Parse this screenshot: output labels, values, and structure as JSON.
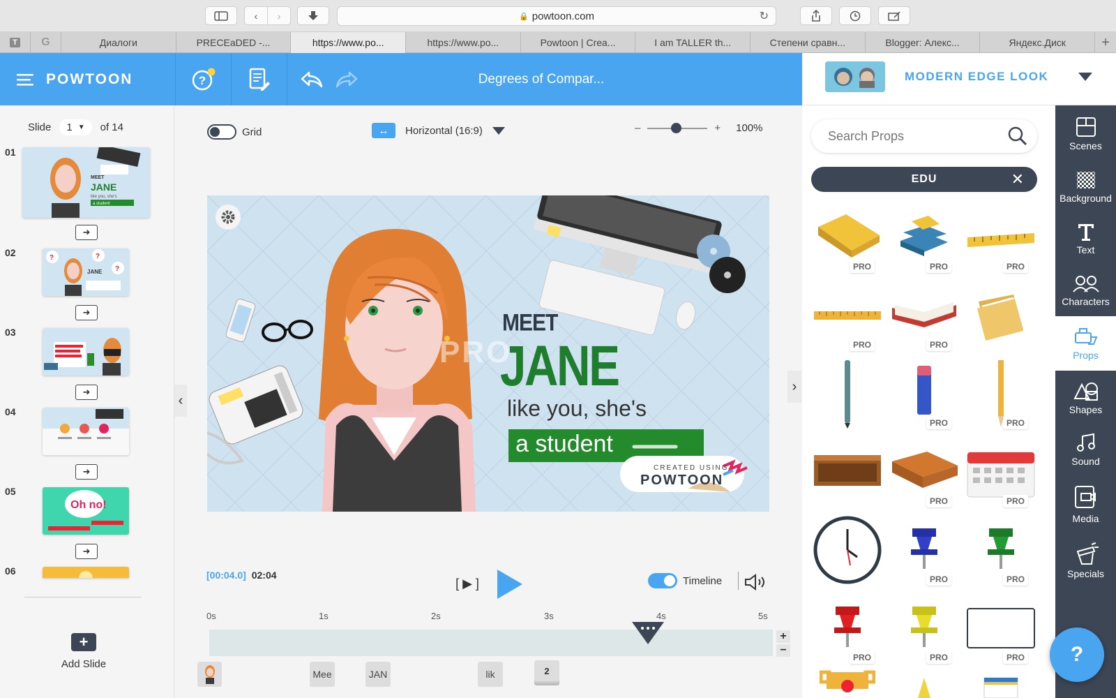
{
  "browser": {
    "url": "powtoon.com",
    "tabs": [
      "Диалоги",
      "PRECEaDED -...",
      "https://www.po...",
      "https://www.po...",
      "Powtoon | Crea...",
      "I am TALLER th...",
      "Степени сравн...",
      "Blogger: Алекс...",
      "Яндекс.Диск"
    ],
    "active_tab": 2
  },
  "header": {
    "logo": "POWTOON",
    "title": "Degrees of Compar...",
    "style_name": "MODERN EDGE LOOK"
  },
  "slides_panel": {
    "slide_label": "Slide",
    "current_slide": "1",
    "of_label": "of 14",
    "numbers": [
      "01",
      "02",
      "03",
      "04",
      "05",
      "06"
    ],
    "add_slide": "Add Slide",
    "thumb2_text": "JANE",
    "thumb5_text": "Oh no!"
  },
  "canvas_toolbar": {
    "grid_label": "Grid",
    "ratio_label": "Horizontal (16:9)",
    "zoom_minus": "–",
    "zoom_plus": "+",
    "zoom_value": "100%"
  },
  "stage": {
    "meet": "MEET",
    "name": "JANE",
    "line": "like you, she's",
    "banner": "a student",
    "watermark": "PRO",
    "created_using": "CREATED USING",
    "brand": "POWTOON"
  },
  "playback": {
    "current_time": "[00:04.0]",
    "duration": "02:04",
    "timeline_label": "Timeline",
    "ticks": [
      "0s",
      "1s",
      "2s",
      "3s",
      "4s",
      "5s"
    ],
    "track_items": [
      "Mee",
      "JAN",
      "lik",
      "2"
    ]
  },
  "props_panel": {
    "search_placeholder": "Search Props",
    "category": "EDU",
    "pro_badge": "PRO"
  },
  "sidebar": {
    "items": [
      "Scenes",
      "Background",
      "Text",
      "Characters",
      "Props",
      "Shapes",
      "Sound",
      "Media",
      "Specials"
    ]
  },
  "help": "?",
  "colors": {
    "header_blue": "#49a5ef",
    "sidebar_dark": "#3d4654",
    "jane_green": "#1e7e2e",
    "banner_green": "#238b2b"
  }
}
